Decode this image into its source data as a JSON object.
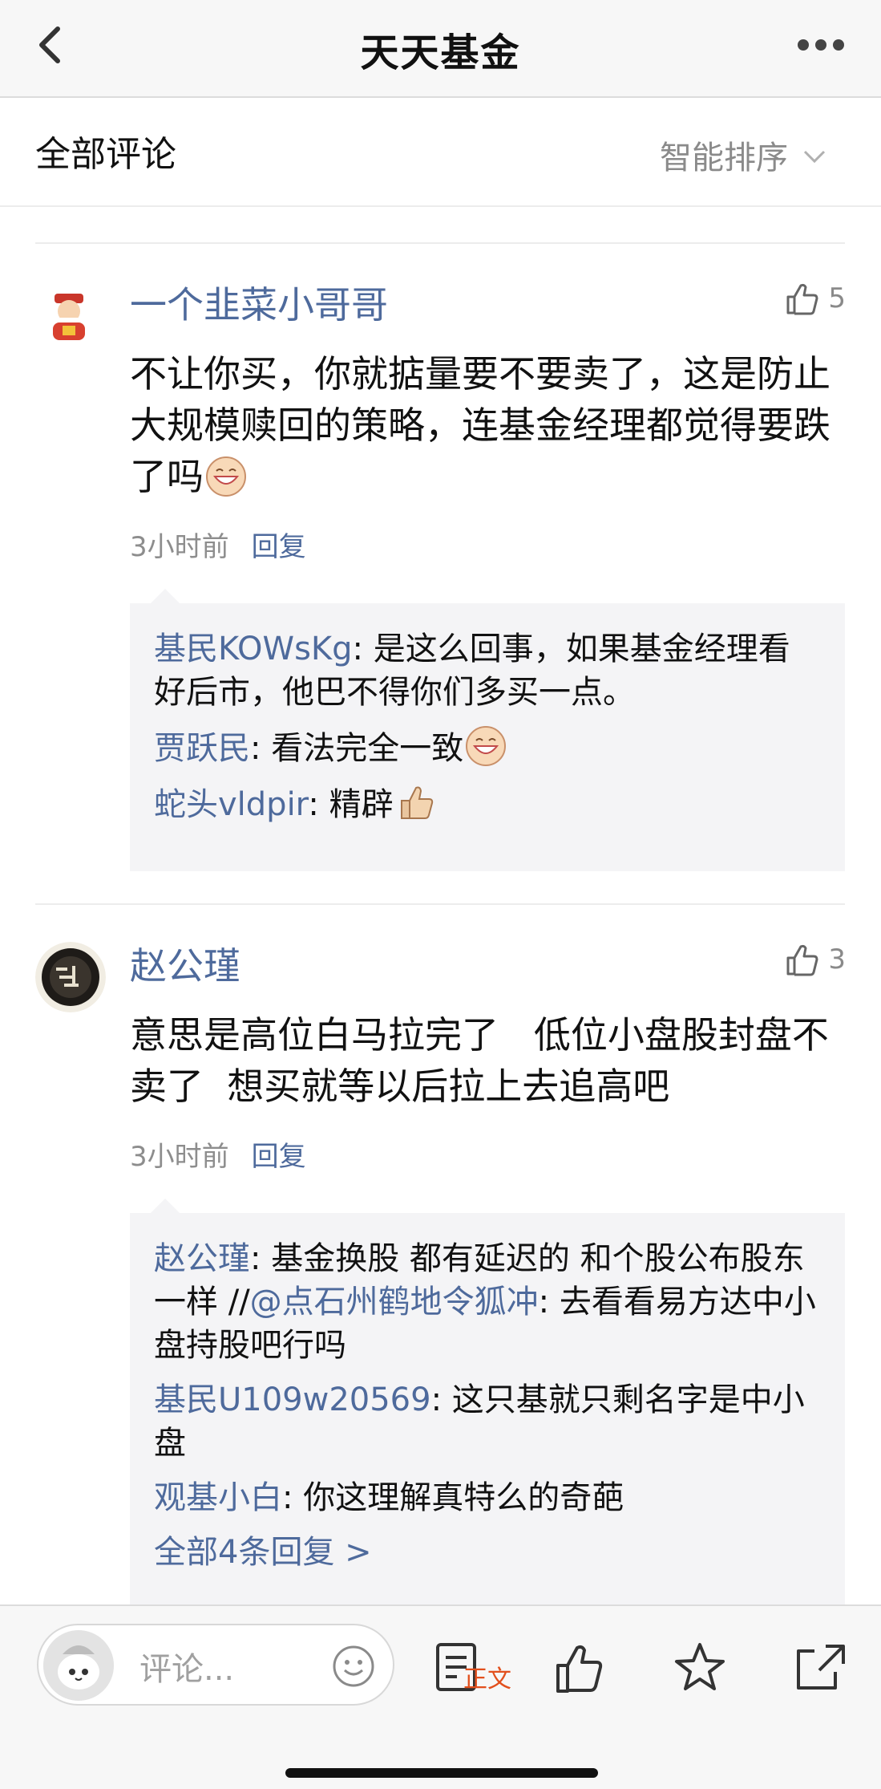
{
  "header": {
    "title": "天天基金"
  },
  "section": {
    "title": "全部评论",
    "sort_label": "智能排序"
  },
  "comments": [
    {
      "name": "一个韭菜小哥哥",
      "likes": "5",
      "text": "不让你买，你就掂量要不要卖了，这是防止大规模赎回的策略，连基金经理都觉得要跌了吗",
      "time": "3小时前",
      "reply_label": "回复",
      "replies": [
        {
          "who": "基民KOWsKg",
          "text": ": 是这么回事，如果基金经理看好后市，他巴不得你们多买一点。"
        },
        {
          "who": "贾跃民",
          "text": ": 看法完全一致"
        },
        {
          "who": "蛇头vldpir",
          "text": ": 精辟"
        }
      ]
    },
    {
      "name": "赵公瑾",
      "likes": "3",
      "text": "意思是高位白马拉完了   低位小盘股封盘不卖了  想买就等以后拉上去追高吧",
      "time": "3小时前",
      "reply_label": "回复",
      "replies": [
        {
          "who": "赵公瑾",
          "text_a": ": 基金换股 都有延迟的  和个股公布股东一样 //",
          "at": "@点石州鹤地令狐冲",
          "text_b": ": 去看看易方达中小盘持股吧行吗"
        },
        {
          "who": "基民U109w20569",
          "text": ": 这只基就只剩名字是中小盘"
        },
        {
          "who": "观基小白",
          "text": ": 你这理解真特么的奇葩"
        }
      ],
      "more_replies": "全部4条回复 >"
    }
  ],
  "bottom": {
    "placeholder": "评论...",
    "article_label": "正文"
  }
}
